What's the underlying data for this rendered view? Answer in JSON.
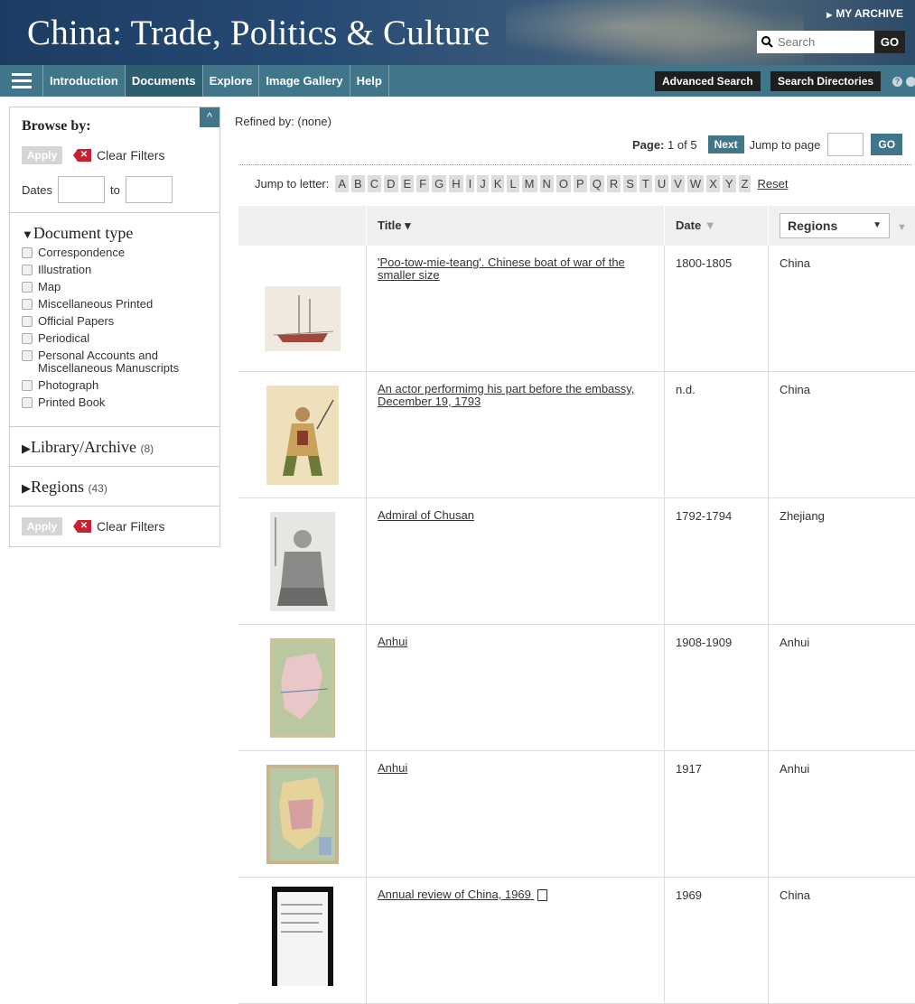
{
  "header": {
    "title": "China: Trade, Politics & Culture",
    "my_archive": "MY ARCHIVE",
    "search_placeholder": "Search",
    "search_go": "GO"
  },
  "nav": {
    "items": [
      "Introduction",
      "Documents",
      "Explore",
      "Image Gallery",
      "Help"
    ],
    "active": "Documents",
    "advanced_search": "Advanced Search",
    "search_directories": "Search Directories"
  },
  "sidebar": {
    "browse_by": "Browse by:",
    "apply": "Apply",
    "clear_filters": "Clear Filters",
    "dates_label": "Dates",
    "dates_to": "to",
    "doc_type_title": "Document type",
    "doc_types": [
      "Correspondence",
      "Illustration",
      "Map",
      "Miscellaneous Printed",
      "Official Papers",
      "Periodical",
      "Personal Accounts and Miscellaneous Manuscripts",
      "Photograph",
      "Printed Book"
    ],
    "library_title": "Library/Archive",
    "library_count": "(8)",
    "regions_title": "Regions",
    "regions_count": "(43)"
  },
  "main": {
    "refined_by": "Refined by: (none)",
    "page_label": "Page:",
    "page_value": "1 of 5",
    "next": "Next",
    "jump_to_page": "Jump to page",
    "go": "GO",
    "jump_to_letter": "Jump to letter:",
    "letters": [
      "A",
      "B",
      "C",
      "D",
      "E",
      "F",
      "G",
      "H",
      "I",
      "J",
      "K",
      "L",
      "M",
      "N",
      "O",
      "P",
      "Q",
      "R",
      "S",
      "T",
      "U",
      "V",
      "W",
      "X",
      "Y",
      "Z"
    ],
    "reset": "Reset"
  },
  "table": {
    "col_title": "Title ▾",
    "col_date": "Date",
    "col_regions": "Regions",
    "rows": [
      {
        "title": "'Poo-tow-mie-teang'. Chinese boat of war of the smaller size",
        "date": "1800-1805",
        "region": "China"
      },
      {
        "title": "An actor performimg his part before the embassy, December 19, 1793",
        "date": "n.d.",
        "region": "China"
      },
      {
        "title": "Admiral of Chusan",
        "date": "1792-1794",
        "region": "Zhejiang"
      },
      {
        "title": "Anhui",
        "date": "1908-1909",
        "region": "Anhui"
      },
      {
        "title": "Anhui",
        "date": "1917",
        "region": "Anhui"
      },
      {
        "title": "Annual review of China, 1969",
        "date": "1969",
        "region": "China"
      }
    ]
  }
}
